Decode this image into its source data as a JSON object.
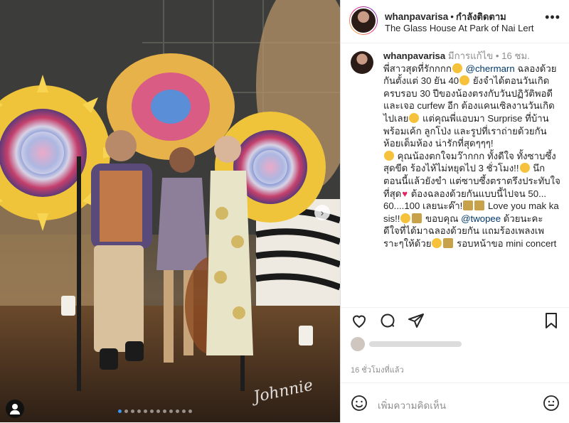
{
  "colors": {
    "accent": "#3897f0",
    "mention": "#00376b",
    "muted": "#8e8e8e",
    "heart": "#e0245e"
  },
  "header": {
    "username": "whanpavarisa",
    "separator": "•",
    "follow_label": "กำลังติดตาม",
    "location": "The Glass House At Park of Nai Lert",
    "more_icon": "more-icon"
  },
  "photo": {
    "signature": "Johnnie",
    "carousel_dots": 12,
    "active_dot": 0,
    "next_icon": "chevron-right-icon",
    "tag_icon": "user-tag-icon"
  },
  "caption": {
    "username": "whanpavarisa",
    "edited": "มีการแก้ไข",
    "time": "• 16 ชม.",
    "mention1": "@chermarn",
    "mention2": "@twopee",
    "line1": "พี่สาวสุดที่รักกกก",
    "seg1": "ฉลองด้วยกันตั้งแต่ 30 ยัน 40",
    "seg2": "ยังจำได้ตอนวันเกิดครบรอบ 30 ปีของน้องตรงกับวันปฏิวัติพอดีและเจอ curfew อีก ต้องแคนเซิลงานวันเกิดไปเลย",
    "seg3": "แต่คุณพี่แอบมา Surprise ที่บ้านพร้อมเค้ก ลูกโป่ง และรูปที่เราถ่ายด้วยกันห้อยเต็มห้อง น่ารักที่สุดๆๆๆ!",
    "seg4": "คุณน้องตกใจมว๊ากกก ทั้งดีใจ ทั้งซาบซึ้งสุดขีด ร้องไห้ไม่หยุดไป 3 ชั่วโมง!!",
    "seg5": "นึกตอนนี้แล้วยังขำ แต่ซาบซึ้งตราตรึงประทับใจที่สุด",
    "seg6": "ต้องฉลองด้วยกันแบบนี้ไปจน 50... 60....100 เลยนะค๊า!",
    "seg7": "Love you mak ka sis!!",
    "seg8": "ขอบคุณ",
    "seg9": "ด้วยนะคะ ดีใจที่ได้มาฉลองด้วยกัน แถมร้องเพลงเพราะๆให้ด้วย",
    "seg10": "รอบหน้าขอ mini concert"
  },
  "actions": {
    "like_icon": "heart-icon",
    "comment_icon": "comment-icon",
    "share_icon": "share-icon",
    "save_icon": "bookmark-icon"
  },
  "time_ago": "16 ชั่วโมงที่แล้ว",
  "comment_box": {
    "placeholder": "เพิ่มความคิดเห็น",
    "emoji_icon": "smiley-icon",
    "post_icon": "emoji-sticker-icon"
  }
}
